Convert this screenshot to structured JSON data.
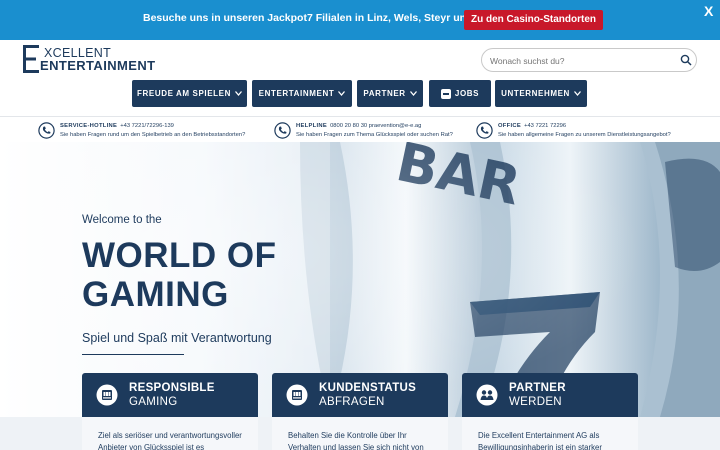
{
  "topbar": {
    "message": "Besuche uns in unseren Jackpot7 Filialen in Linz, Wels, Steyr und Vöcklabruck",
    "button_label": "Zu den Casino-Standorten",
    "close_label": "X"
  },
  "logo": {
    "line1": "XCELLENT",
    "line2": "ENTERTAINMENT"
  },
  "search": {
    "placeholder": "Wonach suchst du?",
    "icon": "search-icon"
  },
  "nav": {
    "items": [
      {
        "label": "FREUDE AM SPIELEN",
        "dropdown": true
      },
      {
        "label": "ENTERTAINMENT",
        "dropdown": true
      },
      {
        "label": "PARTNER",
        "dropdown": true
      },
      {
        "label": "JOBS",
        "dropdown": false,
        "icon": "briefcase-icon"
      },
      {
        "label": "UNTERNEHMEN",
        "dropdown": true
      }
    ]
  },
  "infobar": {
    "items": [
      {
        "title": "SERVICE-HOTLINE",
        "contact": "+43 7221/72296-139",
        "text": "Sie haben Fragen rund um den Spielbetrieb an den Betriebsstandorten?",
        "icon": "phone-icon"
      },
      {
        "title": "HELPLINE",
        "contact": "0800 20 80 30  praevention@e-e.ag",
        "text": "Sie haben Fragen zum Thema Glücksspiel oder suchen Rat?",
        "icon": "phone-icon"
      },
      {
        "title": "OFFICE",
        "contact": "+43 7221 72296",
        "text": "Sie haben allgemeine Fragen zu unserem Dienstleistungsangebot?",
        "icon": "phone-icon"
      }
    ]
  },
  "hero": {
    "welcome": "Welcome to the",
    "title_line1": "WORLD OF",
    "title_line2": "GAMING",
    "subtitle": "Spiel und Spaß mit Verantwortung",
    "art_text": "BAR"
  },
  "cards": [
    {
      "title": "RESPONSIBLE",
      "subtitle": "GAMING",
      "text": "Ziel als seriöser und verantwortungsvoller Anbieter von Glücksspiel ist es",
      "icon": "slot-machine-icon"
    },
    {
      "title": "KUNDENSTATUS",
      "subtitle": "ABFRAGEN",
      "text": "Behalten Sie die Kontrolle über Ihr Verhalten und lassen Sie sich nicht von",
      "icon": "slot-machine-icon"
    },
    {
      "title": "PARTNER",
      "subtitle": "WERDEN",
      "text": "Die Excellent Entertainment AG als Bewilligungsinhaberin ist ein starker",
      "icon": "partner-icon"
    }
  ],
  "colors": {
    "brand_navy": "#1d3a5c",
    "banner_blue": "#1a8fcf",
    "cta_red": "#c8182a"
  }
}
